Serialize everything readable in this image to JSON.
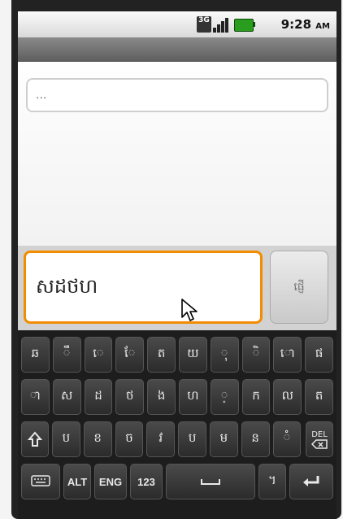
{
  "status": {
    "network": "3G",
    "time": "9:28",
    "ampm": "AM"
  },
  "search": {
    "placeholder": "..."
  },
  "compose": {
    "text": "សដថហ",
    "send_label": "ផ្ញើ"
  },
  "keyboard": {
    "row1": [
      "ឆ",
      "ឹ",
      "េ",
      "ែ",
      "ត",
      "យ",
      "ុ",
      "ិ",
      "ោ",
      "ផ"
    ],
    "row2": [
      "ា",
      "ស",
      "ដ",
      "ថ",
      "ង",
      "ហ",
      "្",
      "ក",
      "ល",
      "ត"
    ],
    "row3": [
      "ប",
      "ខ",
      "ច",
      "វ",
      "ប",
      "ម",
      "ន",
      "ំ"
    ],
    "row4": {
      "alt": "ALT",
      "eng": "ENG",
      "num": "123",
      "extra": "។"
    },
    "del_label": "DEL"
  },
  "colors": {
    "focus": "#f28c00",
    "battery": "#2a9d1f"
  }
}
